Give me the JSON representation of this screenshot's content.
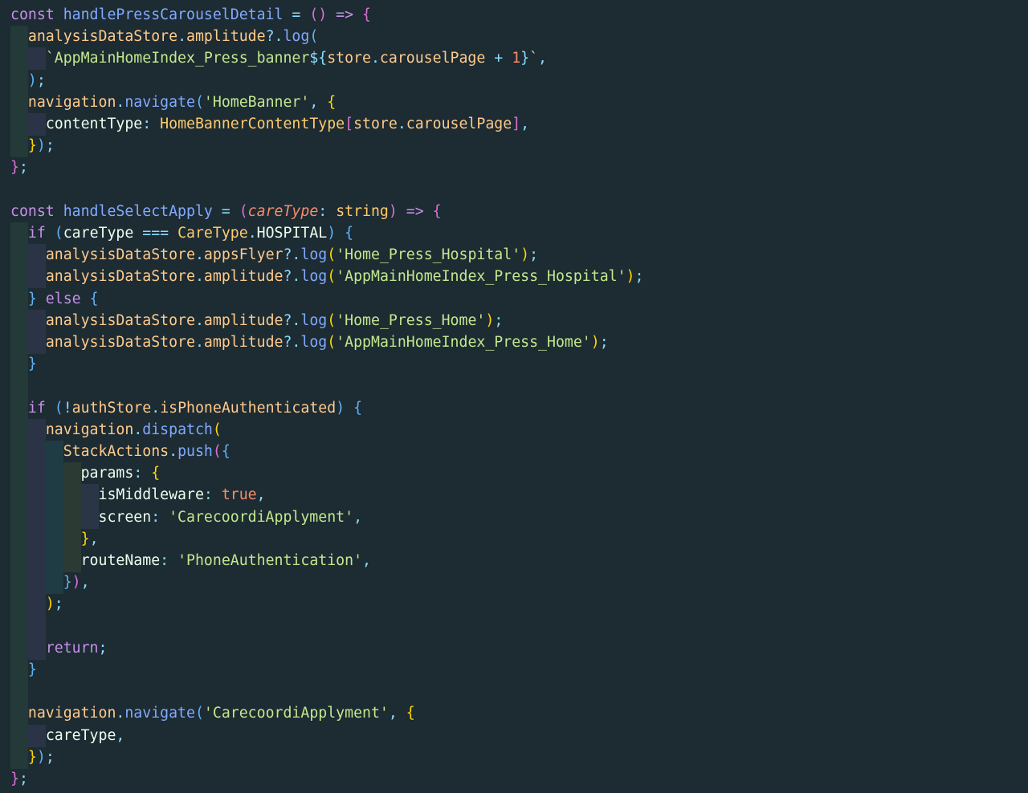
{
  "editor": {
    "theme_colors": {
      "background": "#1d2b33",
      "keyword": "#c791ea",
      "function": "#82aaff",
      "string": "#c3e88d",
      "number": "#f78c6c",
      "identifier": "#eeffee",
      "property": "#ffcb8b"
    },
    "lines": [
      [
        {
          "t": "const ",
          "c": "kw"
        },
        {
          "t": "handlePressCarouselDetail",
          "c": "fn"
        },
        {
          "t": " = ",
          "c": "punc"
        },
        {
          "t": "()",
          "c": "br2"
        },
        {
          "t": " => ",
          "c": "kw"
        },
        {
          "t": "{",
          "c": "br2"
        }
      ],
      [
        {
          "t": "  ",
          "c": "txt"
        },
        {
          "t": "analysisDataStore",
          "c": "prop"
        },
        {
          "t": ".",
          "c": "punc"
        },
        {
          "t": "amplitude",
          "c": "prop"
        },
        {
          "t": "?.",
          "c": "punc"
        },
        {
          "t": "log",
          "c": "fn"
        },
        {
          "t": "(",
          "c": "br3"
        }
      ],
      [
        {
          "t": "    ",
          "c": "txt"
        },
        {
          "t": "`AppMainHomeIndex_Press_banner",
          "c": "str"
        },
        {
          "t": "${",
          "c": "punc"
        },
        {
          "t": "store",
          "c": "prop"
        },
        {
          "t": ".",
          "c": "punc"
        },
        {
          "t": "carouselPage",
          "c": "prop"
        },
        {
          "t": " + ",
          "c": "punc"
        },
        {
          "t": "1",
          "c": "num"
        },
        {
          "t": "}",
          "c": "punc"
        },
        {
          "t": "`",
          "c": "str"
        },
        {
          "t": ",",
          "c": "punc"
        }
      ],
      [
        {
          "t": "  ",
          "c": "txt"
        },
        {
          "t": ")",
          "c": "br3"
        },
        {
          "t": ";",
          "c": "punc"
        }
      ],
      [
        {
          "t": "  ",
          "c": "txt"
        },
        {
          "t": "navigation",
          "c": "prop"
        },
        {
          "t": ".",
          "c": "punc"
        },
        {
          "t": "navigate",
          "c": "fn"
        },
        {
          "t": "(",
          "c": "br3"
        },
        {
          "t": "'HomeBanner'",
          "c": "str"
        },
        {
          "t": ", ",
          "c": "punc"
        },
        {
          "t": "{",
          "c": "br1"
        }
      ],
      [
        {
          "t": "    ",
          "c": "txt"
        },
        {
          "t": "contentType",
          "c": "id"
        },
        {
          "t": ": ",
          "c": "punc"
        },
        {
          "t": "HomeBannerContentType",
          "c": "cls"
        },
        {
          "t": "[",
          "c": "br2"
        },
        {
          "t": "store",
          "c": "prop"
        },
        {
          "t": ".",
          "c": "punc"
        },
        {
          "t": "carouselPage",
          "c": "prop"
        },
        {
          "t": "]",
          "c": "br2"
        },
        {
          "t": ",",
          "c": "punc"
        }
      ],
      [
        {
          "t": "  ",
          "c": "txt"
        },
        {
          "t": "}",
          "c": "br1"
        },
        {
          "t": ")",
          "c": "br3"
        },
        {
          "t": ";",
          "c": "punc"
        }
      ],
      [
        {
          "t": "}",
          "c": "br2"
        },
        {
          "t": ";",
          "c": "punc"
        }
      ],
      [],
      [
        {
          "t": "const ",
          "c": "kw"
        },
        {
          "t": "handleSelectApply",
          "c": "fn"
        },
        {
          "t": " = ",
          "c": "punc"
        },
        {
          "t": "(",
          "c": "br2"
        },
        {
          "t": "careType",
          "c": "param"
        },
        {
          "t": ": ",
          "c": "punc"
        },
        {
          "t": "string",
          "c": "type"
        },
        {
          "t": ")",
          "c": "br2"
        },
        {
          "t": " => ",
          "c": "kw"
        },
        {
          "t": "{",
          "c": "br2"
        }
      ],
      [
        {
          "t": "  ",
          "c": "txt"
        },
        {
          "t": "if ",
          "c": "kw"
        },
        {
          "t": "(",
          "c": "br3"
        },
        {
          "t": "careType",
          "c": "id"
        },
        {
          "t": " === ",
          "c": "punc"
        },
        {
          "t": "CareType",
          "c": "cls"
        },
        {
          "t": ".",
          "c": "punc"
        },
        {
          "t": "HOSPITAL",
          "c": "id"
        },
        {
          "t": ")",
          "c": "br3"
        },
        {
          "t": " ",
          "c": "txt"
        },
        {
          "t": "{",
          "c": "br3"
        }
      ],
      [
        {
          "t": "    ",
          "c": "txt"
        },
        {
          "t": "analysisDataStore",
          "c": "prop"
        },
        {
          "t": ".",
          "c": "punc"
        },
        {
          "t": "appsFlyer",
          "c": "prop"
        },
        {
          "t": "?.",
          "c": "punc"
        },
        {
          "t": "log",
          "c": "fn"
        },
        {
          "t": "(",
          "c": "br1"
        },
        {
          "t": "'Home_Press_Hospital'",
          "c": "str"
        },
        {
          "t": ")",
          "c": "br1"
        },
        {
          "t": ";",
          "c": "punc"
        }
      ],
      [
        {
          "t": "    ",
          "c": "txt"
        },
        {
          "t": "analysisDataStore",
          "c": "prop"
        },
        {
          "t": ".",
          "c": "punc"
        },
        {
          "t": "amplitude",
          "c": "prop"
        },
        {
          "t": "?.",
          "c": "punc"
        },
        {
          "t": "log",
          "c": "fn"
        },
        {
          "t": "(",
          "c": "br1"
        },
        {
          "t": "'AppMainHomeIndex_Press_Hospital'",
          "c": "str"
        },
        {
          "t": ")",
          "c": "br1"
        },
        {
          "t": ";",
          "c": "punc"
        }
      ],
      [
        {
          "t": "  ",
          "c": "txt"
        },
        {
          "t": "}",
          "c": "br3"
        },
        {
          "t": " else ",
          "c": "kw"
        },
        {
          "t": "{",
          "c": "br3"
        }
      ],
      [
        {
          "t": "    ",
          "c": "txt"
        },
        {
          "t": "analysisDataStore",
          "c": "prop"
        },
        {
          "t": ".",
          "c": "punc"
        },
        {
          "t": "amplitude",
          "c": "prop"
        },
        {
          "t": "?.",
          "c": "punc"
        },
        {
          "t": "log",
          "c": "fn"
        },
        {
          "t": "(",
          "c": "br1"
        },
        {
          "t": "'Home_Press_Home'",
          "c": "str"
        },
        {
          "t": ")",
          "c": "br1"
        },
        {
          "t": ";",
          "c": "punc"
        }
      ],
      [
        {
          "t": "    ",
          "c": "txt"
        },
        {
          "t": "analysisDataStore",
          "c": "prop"
        },
        {
          "t": ".",
          "c": "punc"
        },
        {
          "t": "amplitude",
          "c": "prop"
        },
        {
          "t": "?.",
          "c": "punc"
        },
        {
          "t": "log",
          "c": "fn"
        },
        {
          "t": "(",
          "c": "br1"
        },
        {
          "t": "'AppMainHomeIndex_Press_Home'",
          "c": "str"
        },
        {
          "t": ")",
          "c": "br1"
        },
        {
          "t": ";",
          "c": "punc"
        }
      ],
      [
        {
          "t": "  ",
          "c": "txt"
        },
        {
          "t": "}",
          "c": "br3"
        }
      ],
      [],
      [
        {
          "t": "  ",
          "c": "txt"
        },
        {
          "t": "if ",
          "c": "kw"
        },
        {
          "t": "(",
          "c": "br3"
        },
        {
          "t": "!",
          "c": "punc"
        },
        {
          "t": "authStore",
          "c": "prop"
        },
        {
          "t": ".",
          "c": "punc"
        },
        {
          "t": "isPhoneAuthenticated",
          "c": "prop"
        },
        {
          "t": ")",
          "c": "br3"
        },
        {
          "t": " ",
          "c": "txt"
        },
        {
          "t": "{",
          "c": "br3"
        }
      ],
      [
        {
          "t": "    ",
          "c": "txt"
        },
        {
          "t": "navigation",
          "c": "prop"
        },
        {
          "t": ".",
          "c": "punc"
        },
        {
          "t": "dispatch",
          "c": "fn"
        },
        {
          "t": "(",
          "c": "br1"
        }
      ],
      [
        {
          "t": "      ",
          "c": "txt"
        },
        {
          "t": "StackActions",
          "c": "prop"
        },
        {
          "t": ".",
          "c": "punc"
        },
        {
          "t": "push",
          "c": "fn"
        },
        {
          "t": "(",
          "c": "br2"
        },
        {
          "t": "{",
          "c": "br3"
        }
      ],
      [
        {
          "t": "        ",
          "c": "txt"
        },
        {
          "t": "params",
          "c": "id"
        },
        {
          "t": ": ",
          "c": "punc"
        },
        {
          "t": "{",
          "c": "br1"
        }
      ],
      [
        {
          "t": "          ",
          "c": "txt"
        },
        {
          "t": "isMiddleware",
          "c": "id"
        },
        {
          "t": ": ",
          "c": "punc"
        },
        {
          "t": "true",
          "c": "num"
        },
        {
          "t": ",",
          "c": "punc"
        }
      ],
      [
        {
          "t": "          ",
          "c": "txt"
        },
        {
          "t": "screen",
          "c": "id"
        },
        {
          "t": ": ",
          "c": "punc"
        },
        {
          "t": "'CarecoordiApplyment'",
          "c": "str"
        },
        {
          "t": ",",
          "c": "punc"
        }
      ],
      [
        {
          "t": "        ",
          "c": "txt"
        },
        {
          "t": "}",
          "c": "br1"
        },
        {
          "t": ",",
          "c": "punc"
        }
      ],
      [
        {
          "t": "        ",
          "c": "txt"
        },
        {
          "t": "routeName",
          "c": "id"
        },
        {
          "t": ": ",
          "c": "punc"
        },
        {
          "t": "'PhoneAuthentication'",
          "c": "str"
        },
        {
          "t": ",",
          "c": "punc"
        }
      ],
      [
        {
          "t": "      ",
          "c": "txt"
        },
        {
          "t": "}",
          "c": "br3"
        },
        {
          "t": ")",
          "c": "br2"
        },
        {
          "t": ",",
          "c": "punc"
        }
      ],
      [
        {
          "t": "    ",
          "c": "txt"
        },
        {
          "t": ")",
          "c": "br1"
        },
        {
          "t": ";",
          "c": "punc"
        }
      ],
      [],
      [
        {
          "t": "    ",
          "c": "txt"
        },
        {
          "t": "return",
          "c": "kw"
        },
        {
          "t": ";",
          "c": "punc"
        }
      ],
      [
        {
          "t": "  ",
          "c": "txt"
        },
        {
          "t": "}",
          "c": "br3"
        }
      ],
      [],
      [
        {
          "t": "  ",
          "c": "txt"
        },
        {
          "t": "navigation",
          "c": "prop"
        },
        {
          "t": ".",
          "c": "punc"
        },
        {
          "t": "navigate",
          "c": "fn"
        },
        {
          "t": "(",
          "c": "br3"
        },
        {
          "t": "'CarecoordiApplyment'",
          "c": "str"
        },
        {
          "t": ", ",
          "c": "punc"
        },
        {
          "t": "{",
          "c": "br1"
        }
      ],
      [
        {
          "t": "    ",
          "c": "txt"
        },
        {
          "t": "careType",
          "c": "id"
        },
        {
          "t": ",",
          "c": "punc"
        }
      ],
      [
        {
          "t": "  ",
          "c": "txt"
        },
        {
          "t": "}",
          "c": "br1"
        },
        {
          "t": ")",
          "c": "br3"
        },
        {
          "t": ";",
          "c": "punc"
        }
      ],
      [
        {
          "t": "}",
          "c": "br2"
        },
        {
          "t": ";",
          "c": "punc"
        }
      ]
    ]
  }
}
